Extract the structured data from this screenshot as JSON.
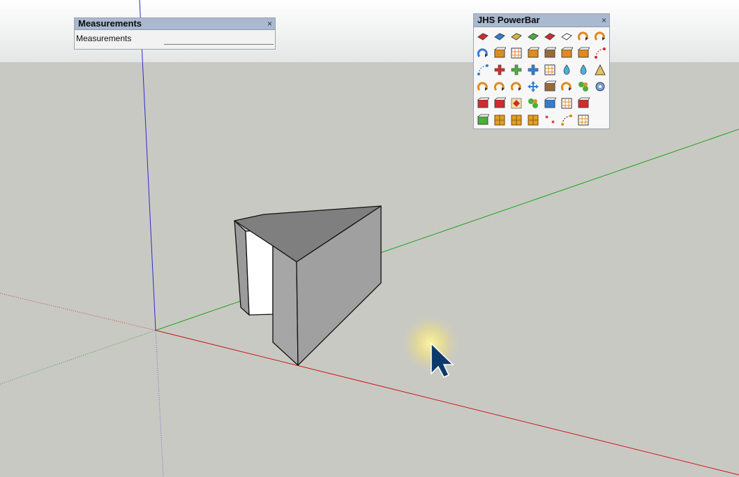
{
  "measurements": {
    "title": "Measurements",
    "close": "×",
    "label": "Measurements",
    "value": ""
  },
  "powerbar": {
    "title": "JHS PowerBar",
    "close": "×",
    "rows": [
      [
        "face-red-icon",
        "face-blue-icon",
        "face-yellow-icon",
        "face-green-icon",
        "face-red-grid-icon",
        "face-outline-icon",
        "bend-orange-icon",
        "bend-orange-alt-icon"
      ],
      [
        "bend-blue-icon",
        "square-corner-icon",
        "stripes-icon",
        "flag-icon",
        "wood-block-icon",
        "pipe-icon",
        "sweep-icon",
        "dot-curve-red-icon"
      ],
      [
        "dot-curve-blue-icon",
        "cross-red-icon",
        "cross-green-icon",
        "cross-blue-icon",
        "grid-dots-icon",
        "drop-icon",
        "drop-alt-icon",
        "tent-icon"
      ],
      [
        "rotate-orange-icon",
        "rotate-split-icon",
        "rotate-multi-icon",
        "move-blue-icon",
        "box-wood-icon",
        "magnet-icon",
        "puzzle-green-icon",
        "gear-blue-icon"
      ],
      [
        "box-red-icon",
        "box-red-alt-icon",
        "red-diamond-icon",
        "green-cluster-icon",
        "panel-blue-icon",
        "grid-panel-icon",
        "window-red-icon"
      ],
      [
        "sheet-green-icon",
        "tile-orange-icon",
        "tile-orange-quad-icon",
        "tile-orange-grid-icon",
        "scatter-red-icon",
        "arc-dots-icon",
        "component-grid-icon"
      ]
    ]
  },
  "colors": {
    "sky": "#f2f2f0",
    "ground": "#c9c9c3",
    "axis_red": "#cc0000",
    "axis_green": "#00aa00",
    "axis_blue": "#0000cc"
  }
}
